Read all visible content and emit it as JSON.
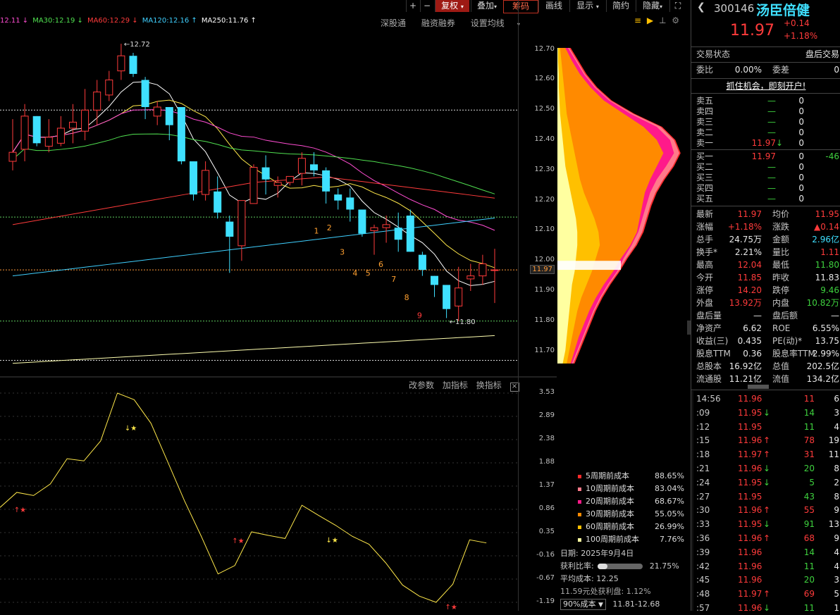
{
  "toolbar": {
    "plus": "+",
    "minus": "−",
    "fuquan": "复权",
    "diejia": "叠加",
    "chouma": "筹码",
    "huaxian": "画线",
    "xianshi": "显示",
    "jianyue": "简约",
    "yincang": "隐藏",
    "expand": "⛶"
  },
  "ma_legend": [
    {
      "label": "12.11",
      "arrow": "↓",
      "color": "#ff4dd2"
    },
    {
      "label": "MA30:12.19",
      "arrow": "↓",
      "color": "#50e050"
    },
    {
      "label": "MA60:12.29",
      "arrow": "↓",
      "color": "#ff3b3b"
    },
    {
      "label": "MA120:12.16",
      "arrow": "↑",
      "color": "#3fd0ff"
    },
    {
      "label": "MA250:11.76",
      "arrow": "↑",
      "color": "#ffffff"
    }
  ],
  "top_links": [
    "深股通",
    "融资融券",
    "设置均线"
  ],
  "price_labels": [
    "12.70",
    "12.60",
    "12.50",
    "12.40",
    "12.30",
    "12.20",
    "12.10",
    "12.00",
    "11.97",
    "11.90",
    "11.80",
    "11.70"
  ],
  "annotations": {
    "high": "12.72",
    "low": "11.80"
  },
  "wave_numbers": [
    "1",
    "2",
    "3",
    "4",
    "5",
    "6",
    "7",
    "8",
    "9"
  ],
  "lower_toolbar": [
    "改参数",
    "加指标",
    "换指标"
  ],
  "indicator_scale": [
    "3.53",
    "2.89",
    "2.38",
    "1.88",
    "1.37",
    "0.86",
    "0.35",
    "-0.16",
    "-0.67",
    "-1.19"
  ],
  "cost_legend": [
    {
      "label": "5周期前成本",
      "value": "88.65%",
      "color": "#ff2a2a"
    },
    {
      "label": "10周期前成本",
      "value": "83.04%",
      "color": "#ff7a8a"
    },
    {
      "label": "20周期前成本",
      "value": "68.67%",
      "color": "#ff1a8a"
    },
    {
      "label": "30周期前成本",
      "value": "55.05%",
      "color": "#ff8a00"
    },
    {
      "label": "60周期前成本",
      "value": "26.99%",
      "color": "#ffc000"
    },
    {
      "label": "100周期前成本",
      "value": "7.76%",
      "color": "#ffffa0"
    }
  ],
  "cost_info": {
    "date": "日期: 2025年9月4日",
    "profit_label": "获利比率:",
    "profit_value": "21.75%",
    "profit_fraction": 0.2175,
    "avg_cost": "平均成本: 12.25",
    "at_price": "11.59元处获利盘: 1.12%",
    "select": "90%成本",
    "range": "11.81-12.68"
  },
  "stock": {
    "code": "300146",
    "name": "汤臣倍健",
    "price": "11.97",
    "change": "+0.14",
    "change_pct": "+1.18%"
  },
  "trade_status": {
    "label": "交易状态",
    "value": "盘后交易"
  },
  "weibi": {
    "k1": "委比",
    "v1": "0.00%",
    "k2": "委差",
    "v2": "0"
  },
  "promo": "抓住机会，即刻开户!",
  "sells": [
    {
      "k": "卖五",
      "p": "—",
      "v": "0"
    },
    {
      "k": "卖四",
      "p": "—",
      "v": "0"
    },
    {
      "k": "卖三",
      "p": "—",
      "v": "0"
    },
    {
      "k": "卖二",
      "p": "—",
      "v": "0"
    },
    {
      "k": "卖一",
      "p": "11.97",
      "arrow": "↓",
      "v": "0"
    }
  ],
  "buys": [
    {
      "k": "买一",
      "p": "11.97",
      "v": "0",
      "ch": "-46"
    },
    {
      "k": "买二",
      "p": "—",
      "v": "0"
    },
    {
      "k": "买三",
      "p": "—",
      "v": "0"
    },
    {
      "k": "买四",
      "p": "—",
      "v": "0"
    },
    {
      "k": "买五",
      "p": "—",
      "v": "0"
    }
  ],
  "stats": [
    {
      "k": "最新",
      "v": "11.97",
      "vc": "red",
      "k2": "均价",
      "v2": "11.95",
      "v2c": "red"
    },
    {
      "k": "涨幅",
      "v": "+1.18%",
      "vc": "red",
      "k2": "涨跌",
      "v2": "▲0.14",
      "v2c": "red"
    },
    {
      "k": "总手",
      "v": "24.75万",
      "vc": "wht",
      "k2": "金额",
      "v2": "2.96亿",
      "v2c": "cyan"
    },
    {
      "k": "换手*",
      "v": "2.21%",
      "vc": "wht",
      "k2": "量比",
      "v2": "1.11",
      "v2c": "red"
    },
    {
      "k": "最高",
      "v": "12.04",
      "vc": "red",
      "k2": "最低",
      "v2": "11.80",
      "v2c": "grn"
    },
    {
      "k": "今开",
      "v": "11.85",
      "vc": "red",
      "k2": "昨收",
      "v2": "11.83",
      "v2c": "wht"
    },
    {
      "k": "涨停",
      "v": "14.20",
      "vc": "red",
      "k2": "跌停",
      "v2": "9.46",
      "v2c": "grn"
    },
    {
      "k": "外盘",
      "v": "13.92万",
      "vc": "red",
      "k2": "内盘",
      "v2": "10.82万",
      "v2c": "grn"
    },
    {
      "k": "盘后量",
      "v": "—",
      "vc": "wht",
      "k2": "盘后额",
      "v2": "—",
      "v2c": "wht"
    },
    {
      "k": "净资产",
      "v": "6.62",
      "vc": "wht",
      "k2": "ROE",
      "v2": "6.55%",
      "v2c": "wht"
    },
    {
      "k": "收益(三)",
      "v": "0.435",
      "vc": "wht",
      "k2": "PE(动)*",
      "v2": "13.75",
      "v2c": "wht"
    },
    {
      "k": "股息TTM",
      "v": "0.36",
      "vc": "wht",
      "k2": "股息率TTM",
      "v2": "2.99%",
      "v2c": "wht"
    },
    {
      "k": "总股本",
      "v": "16.92亿",
      "vc": "wht",
      "k2": "总值",
      "v2": "202.5亿",
      "v2c": "wht"
    },
    {
      "k": "流通股",
      "v": "11.21亿",
      "vc": "wht",
      "k2": "流值",
      "v2": "134.2亿",
      "v2c": "wht"
    }
  ],
  "ticks": [
    {
      "t": "14:56",
      "p": "11.96",
      "a": "",
      "ac": "",
      "v": "11",
      "vc": "red",
      "c": "6"
    },
    {
      "t": ":09",
      "p": "11.95",
      "a": "↓",
      "ac": "grn",
      "v": "14",
      "vc": "grn",
      "c": "3"
    },
    {
      "t": ":12",
      "p": "11.95",
      "a": "",
      "ac": "",
      "v": "11",
      "vc": "grn",
      "c": "4"
    },
    {
      "t": ":15",
      "p": "11.96",
      "a": "↑",
      "ac": "red",
      "v": "78",
      "vc": "red",
      "c": "19"
    },
    {
      "t": ":18",
      "p": "11.97",
      "a": "↑",
      "ac": "red",
      "v": "31",
      "vc": "red",
      "c": "11"
    },
    {
      "t": ":21",
      "p": "11.96",
      "a": "↓",
      "ac": "grn",
      "v": "20",
      "vc": "grn",
      "c": "8"
    },
    {
      "t": ":24",
      "p": "11.95",
      "a": "↓",
      "ac": "grn",
      "v": "5",
      "vc": "grn",
      "c": "2"
    },
    {
      "t": ":27",
      "p": "11.95",
      "a": "",
      "ac": "",
      "v": "43",
      "vc": "grn",
      "c": "8"
    },
    {
      "t": ":30",
      "p": "11.96",
      "a": "↑",
      "ac": "red",
      "v": "55",
      "vc": "red",
      "c": "9"
    },
    {
      "t": ":33",
      "p": "11.95",
      "a": "↓",
      "ac": "grn",
      "v": "91",
      "vc": "grn",
      "c": "13"
    },
    {
      "t": ":36",
      "p": "11.96",
      "a": "↑",
      "ac": "red",
      "v": "68",
      "vc": "red",
      "c": "9"
    },
    {
      "t": ":39",
      "p": "11.96",
      "a": "",
      "ac": "",
      "v": "14",
      "vc": "grn",
      "c": "4"
    },
    {
      "t": ":42",
      "p": "11.96",
      "a": "",
      "ac": "",
      "v": "11",
      "vc": "grn",
      "c": "4"
    },
    {
      "t": ":45",
      "p": "11.96",
      "a": "",
      "ac": "",
      "v": "20",
      "vc": "grn",
      "c": "3"
    },
    {
      "t": ":48",
      "p": "11.97",
      "a": "↑",
      "ac": "red",
      "v": "69",
      "vc": "red",
      "c": "5"
    },
    {
      "t": ":57",
      "p": "11.96",
      "a": "↓",
      "ac": "grn",
      "v": "11",
      "vc": "grn",
      "c": "1"
    }
  ],
  "chart_data": {
    "type": "candlestick",
    "candles": [
      [
        12.33,
        12.47,
        12.3,
        12.36
      ],
      [
        12.37,
        12.52,
        12.33,
        12.48
      ],
      [
        12.48,
        12.48,
        12.38,
        12.39
      ],
      [
        12.38,
        12.47,
        12.36,
        12.41
      ],
      [
        12.39,
        12.48,
        12.38,
        12.44
      ],
      [
        12.44,
        12.52,
        12.39,
        12.46
      ],
      [
        12.43,
        12.57,
        12.4,
        12.5
      ],
      [
        12.5,
        12.6,
        12.45,
        12.56
      ],
      [
        12.55,
        12.63,
        12.53,
        12.6
      ],
      [
        12.63,
        12.72,
        12.6,
        12.68
      ],
      [
        12.68,
        12.69,
        12.61,
        12.62
      ],
      [
        12.6,
        12.61,
        12.47,
        12.51
      ],
      [
        12.48,
        12.53,
        12.45,
        12.51
      ],
      [
        12.51,
        12.51,
        12.4,
        12.45
      ],
      [
        12.51,
        12.51,
        12.32,
        12.33
      ],
      [
        12.33,
        12.33,
        12.2,
        12.22
      ],
      [
        12.22,
        12.33,
        12.2,
        12.3
      ],
      [
        12.23,
        12.28,
        12.14,
        12.16
      ],
      [
        12.13,
        12.15,
        11.96,
        12.08
      ],
      [
        12.05,
        12.2,
        12.0,
        12.2
      ],
      [
        12.19,
        12.32,
        12.19,
        12.31
      ],
      [
        12.31,
        12.35,
        12.22,
        12.27
      ],
      [
        12.25,
        12.28,
        12.21,
        12.26
      ],
      [
        12.26,
        12.28,
        12.25,
        12.28
      ],
      [
        12.29,
        12.36,
        12.25,
        12.34
      ],
      [
        12.32,
        12.36,
        12.28,
        12.3
      ],
      [
        12.3,
        12.31,
        12.19,
        12.23
      ],
      [
        12.22,
        12.24,
        12.17,
        12.2
      ],
      [
        12.21,
        12.24,
        12.13,
        12.17
      ],
      [
        12.17,
        12.17,
        12.08,
        12.09
      ],
      [
        12.1,
        12.12,
        12.02,
        12.11
      ],
      [
        12.11,
        12.15,
        12.06,
        12.12
      ],
      [
        12.11,
        12.16,
        12.03,
        12.07
      ],
      [
        12.15,
        12.17,
        12.03,
        12.03
      ],
      [
        12.02,
        12.03,
        11.95,
        11.97
      ],
      [
        11.95,
        11.95,
        11.88,
        11.92
      ],
      [
        11.92,
        11.92,
        11.81,
        11.84
      ],
      [
        11.85,
        11.98,
        11.8,
        11.91
      ],
      [
        11.94,
        11.99,
        11.9,
        11.95
      ],
      [
        11.95,
        12.02,
        11.92,
        11.99
      ],
      [
        11.97,
        12.04,
        11.86,
        11.97
      ]
    ],
    "ylim": [
      11.65,
      12.76
    ]
  }
}
